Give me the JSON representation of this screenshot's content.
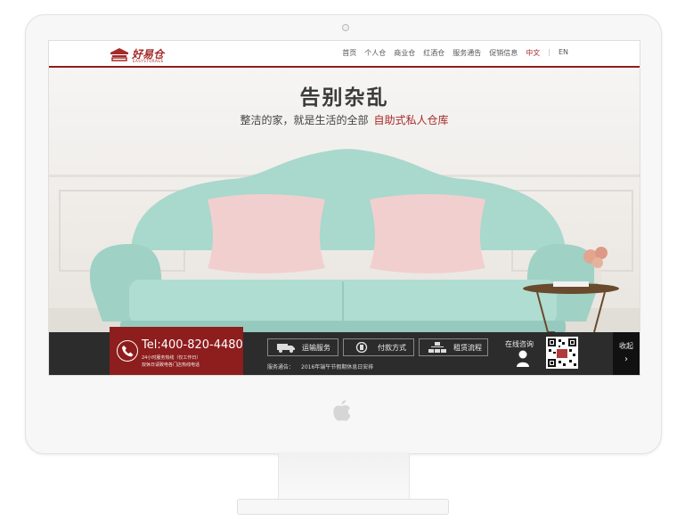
{
  "brand": {
    "name": "好易仓",
    "sub": "EASYSTORAGE"
  },
  "nav": {
    "items": [
      "首页",
      "个人仓",
      "商业仓",
      "红酒仓",
      "服务通告",
      "促销信息"
    ],
    "lang_active": "中文",
    "lang_separator": "|",
    "lang_other": "EN"
  },
  "hero": {
    "title": "告别杂乱",
    "subtitle": "整洁的家，就是生活的全部",
    "highlight": "自助式私人仓库"
  },
  "contact": {
    "phone": "Tel:400-820-4480",
    "note1": "24小时服务热线（仅工作日）",
    "note2": "双休日请致电各门店热线电话"
  },
  "services": {
    "transport": "运输服务",
    "payment": "付款方式",
    "process": "租赁流程"
  },
  "notice": {
    "label": "服务通告：",
    "text": "2016年端午节假期休息日安排"
  },
  "consult": {
    "label": "在线咨询"
  },
  "collapse": {
    "label": "收起",
    "arrow": "›"
  },
  "colors": {
    "brand_red": "#8e1d1d",
    "sofa": "#a8d7cc",
    "bar": "#2c2c2c"
  }
}
